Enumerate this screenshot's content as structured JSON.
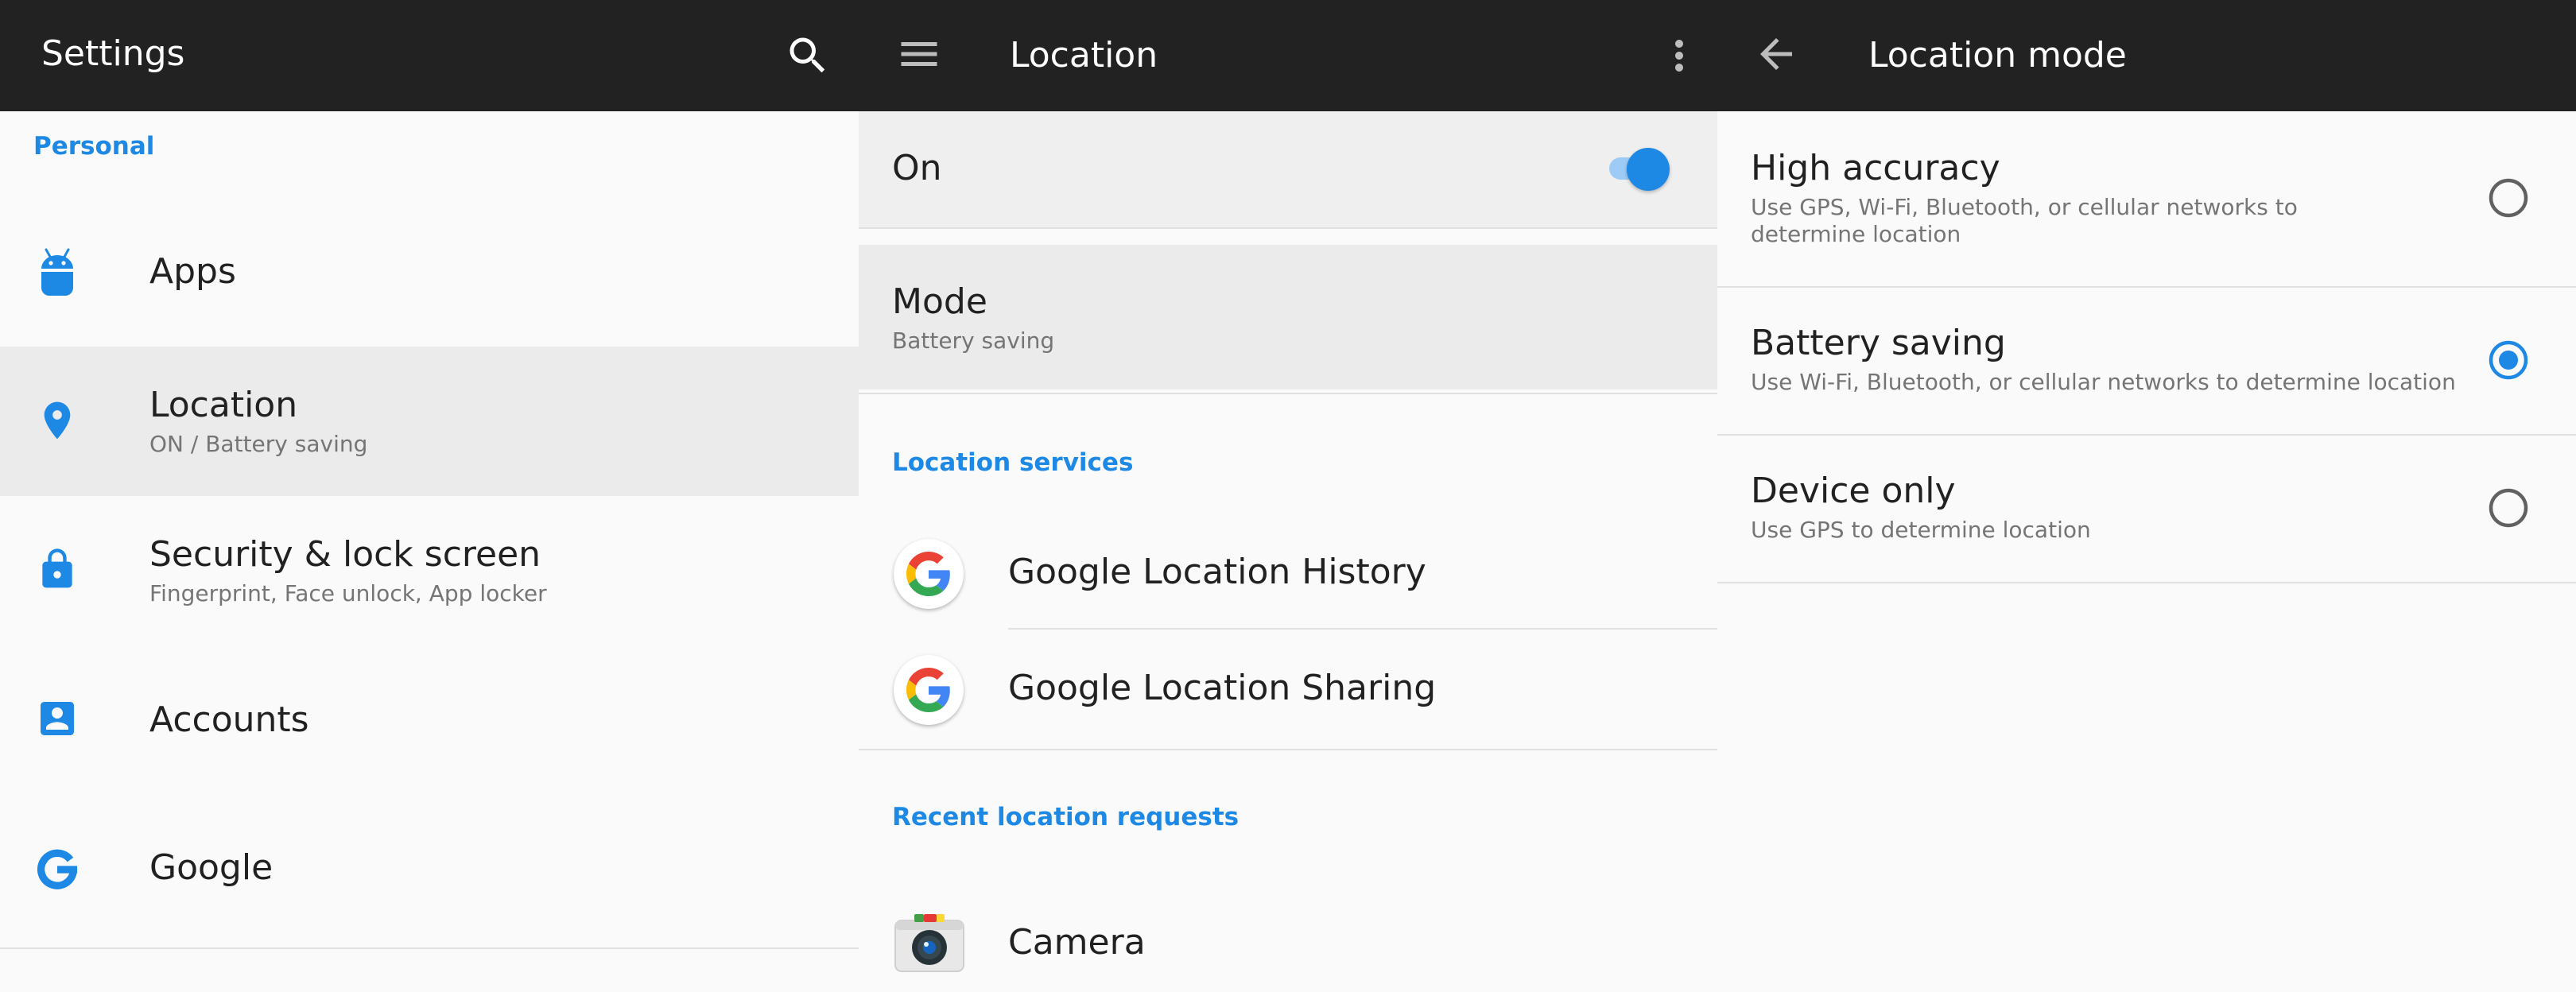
{
  "colors": {
    "accent": "#1e88e5",
    "appbar": "#222222",
    "background": "#fafafa",
    "selected_row": "#ebebeb"
  },
  "settings_screen": {
    "title": "Settings",
    "search_icon": "search-icon",
    "section_personal": "Personal",
    "items": [
      {
        "id": "apps",
        "icon": "android-icon",
        "label": "Apps",
        "summary": ""
      },
      {
        "id": "location",
        "icon": "location-pin-icon",
        "label": "Location",
        "summary": "ON / Battery saving",
        "selected": true
      },
      {
        "id": "security",
        "icon": "lock-icon",
        "label": "Security & lock screen",
        "summary": "Fingerprint, Face unlock, App locker"
      },
      {
        "id": "accounts",
        "icon": "account-box-icon",
        "label": "Accounts",
        "summary": ""
      },
      {
        "id": "google",
        "icon": "google-g-icon",
        "label": "Google",
        "summary": ""
      }
    ]
  },
  "location_screen": {
    "title": "Location",
    "menu_icon": "hamburger-menu-icon",
    "overflow_icon": "more-vert-icon",
    "master_switch": {
      "label": "On",
      "on": true
    },
    "mode": {
      "label": "Mode",
      "value": "Battery saving"
    },
    "section_services": "Location services",
    "services": [
      {
        "icon": "google-g-icon",
        "label": "Google Location History"
      },
      {
        "icon": "google-g-icon",
        "label": "Google Location Sharing"
      }
    ],
    "section_recent": "Recent location requests",
    "recent": [
      {
        "icon": "camera-app-icon",
        "label": "Camera"
      }
    ]
  },
  "location_mode_screen": {
    "title": "Location mode",
    "back_icon": "arrow-back-icon",
    "options": [
      {
        "label": "High accuracy",
        "description": "Use GPS, Wi-Fi, Bluetooth, or cellular networks to determine location",
        "selected": false
      },
      {
        "label": "Battery saving",
        "description": "Use Wi-Fi, Bluetooth, or cellular networks to determine location",
        "selected": true
      },
      {
        "label": "Device only",
        "description": "Use GPS to determine location",
        "selected": false
      }
    ]
  }
}
